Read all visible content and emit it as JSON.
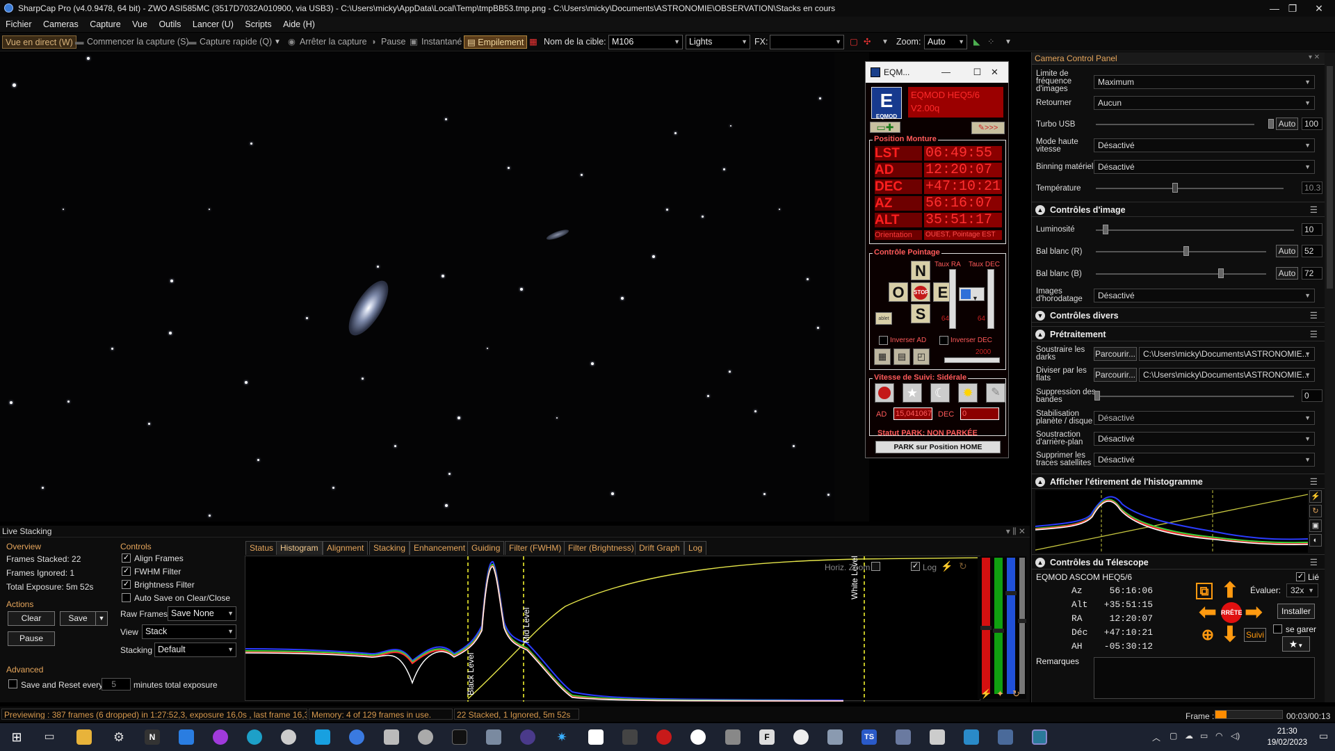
{
  "window": {
    "title": "SharpCap Pro (v4.0.9478, 64 bit) - ZWO ASI585MC (3517D7032A010900, via USB3) - C:\\Users\\micky\\AppData\\Local\\Temp\\tmpBB53.tmp.png - C:\\Users\\micky\\Documents\\ASTRONOMIE\\OBSERVATION\\Stacks en cours",
    "minimize": "—",
    "maximize": "❐",
    "close": "✕"
  },
  "menu": [
    "Fichier",
    "Cameras",
    "Capture",
    "Vue",
    "Outils",
    "Lancer (U)",
    "Scripts",
    "Aide (H)"
  ],
  "toolbar": {
    "live_view": "Vue en direct (W)",
    "start_capture": "Commencer la capture (S)",
    "quick_capture": "Capture rapide (Q)",
    "stop_capture": "Arrêter la capture",
    "pause": "Pause",
    "snapshot": "Instantané",
    "stacking": "Empilement",
    "target_label": "Nom de la cible:",
    "target_value": "M106",
    "frame_type": "Lights",
    "fx_label": "FX:",
    "fx_value": "",
    "zoom_label": "Zoom:",
    "zoom_value": "Auto"
  },
  "eqmod": {
    "window_title": "EQM...",
    "mount_name": "EQMOD HEQ5/6",
    "version": "V2.00q",
    "position_title": "Position Monture",
    "rows": [
      {
        "label": "LST",
        "value": "06:49:55"
      },
      {
        "label": "AD",
        "value": "12:20:07"
      },
      {
        "label": "DEC",
        "value": "+47:10:21"
      },
      {
        "label": "AZ",
        "value": "56:16:07"
      },
      {
        "label": "ALT",
        "value": "35:51:17"
      }
    ],
    "orientation_label": "Orientation",
    "orientation_value": "OUEST, Pointage EST",
    "slew_title": "Contrôle Pointage",
    "rate_ra": "Taux RA",
    "rate_dec": "Taux DEC",
    "btn_n": "N",
    "btn_s": "S",
    "btn_e": "E",
    "btn_o": "O",
    "btn_stop": "STOP",
    "rate_ra_val": "64",
    "rate_dec_val": "64",
    "invert_ad": "Inverser AD",
    "invert_dec": "Inverser DEC",
    "pulse_val": "2000",
    "tablet_label": "ablet",
    "tracking_title": "Vitesse de Suivi: Sidérale",
    "ad_label": "AD",
    "ad_value": "15,041067",
    "dec_label": "DEC",
    "dec_value": "0",
    "park_status": "Statut PARK: NON PARKÉE",
    "park_button": "PARK sur Position HOME"
  },
  "camera_panel": {
    "title": "Camera Control Panel",
    "frame_rate_label": "Limite de fréquence d'images",
    "frame_rate_value": "Maximum",
    "flip_label": "Retourner",
    "flip_value": "Aucun",
    "turbo_label": "Turbo USB",
    "turbo_auto": "Auto",
    "turbo_value": "100",
    "hispeed_label": "Mode haute vitesse",
    "hispeed_value": "Désactivé",
    "binning_label": "Binning matériel",
    "binning_value": "Désactivé",
    "temp_label": "Température",
    "temp_value": "10.3",
    "image_controls": "Contrôles d'image",
    "luminosity_label": "Luminosité",
    "luminosity_value": "10",
    "wb_r_label": "Bal blanc (R)",
    "wb_r_auto": "Auto",
    "wb_r_value": "52",
    "wb_b_label": "Bal blanc (B)",
    "wb_b_auto": "Auto",
    "wb_b_value": "72",
    "timestamp_label": "Images d'horodatage",
    "timestamp_value": "Désactivé",
    "misc_controls": "Contrôles divers",
    "preprocessing": "Prétraitement",
    "darks_label": "Soustraire les darks",
    "darks_btn": "Parcourir...",
    "darks_path": "C:\\Users\\micky\\Documents\\ASTRONOMIE...",
    "flats_label": "Diviser par les flats",
    "flats_btn": "Parcourir...",
    "flats_path": "C:\\Users\\micky\\Documents\\ASTRONOMIE...",
    "banding_label": "Suppression des bandes",
    "banding_value": "0",
    "stabilization_label": "Stabilisation planète / disque",
    "stabilization_value": "Désactivé",
    "bg_sub_label": "Soustraction d'arrière-plan",
    "bg_sub_value": "Désactivé",
    "sat_label": "Supprimer les traces satellites",
    "sat_value": "Désactivé",
    "histogram_stretch": "Afficher l'étirement de l'histogramme",
    "telescope_controls": "Contrôles du Télescope",
    "telescope_name": "EQMOD ASCOM HEQ5/6",
    "linked_label": "Lié",
    "az": "Az     56:16:06",
    "alt": "Alt   +35:51:15",
    "ra": "RA     12:20:07",
    "dec": "Déc   +47:10:21",
    "ah": "AH    -05:30:12",
    "rate_label": "Évaluer:",
    "rate_value": "32x",
    "install_btn": "Installer",
    "park_label": "se garer",
    "stop_btn": "RRÊTE",
    "follow_btn": "Suivi",
    "notes_label": "Remarques"
  },
  "live_stacking": {
    "title": "Live Stacking",
    "overview_head": "Overview",
    "frames_stacked": "Frames Stacked: 22",
    "frames_ignored": "Frames Ignored: 1",
    "total_exposure": "Total Exposure:   5m 52s",
    "actions_head": "Actions",
    "clear_btn": "Clear",
    "save_btn": "Save",
    "pause_btn": "Pause",
    "advanced_head": "Advanced",
    "save_reset_label": "Save and Reset every",
    "save_reset_value": "5",
    "save_reset_unit": "minutes total exposure",
    "controls_head": "Controls",
    "align_frames": "Align Frames",
    "fwhm_filter": "FWHM Filter",
    "brightness_filter": "Brightness Filter",
    "autosave": "Auto Save on Clear/Close",
    "raw_frames_label": "Raw Frames",
    "raw_frames_value": "Save None",
    "view_label": "View",
    "view_value": "Stack",
    "stacking_label": "Stacking",
    "stacking_value": "Default",
    "tabs": [
      "Status",
      "Histogram",
      "Alignment",
      "Stacking",
      "Enhancement",
      "Guiding",
      "Filter (FWHM)",
      "Filter (Brightness)",
      "Drift Graph",
      "Log"
    ],
    "horiz_label": "Horiz. Zoom",
    "log_label": "Log",
    "black_level": "Black Level",
    "mid_level": "Mid Level",
    "white_level": "White Level"
  },
  "status_bar": {
    "previewing": "Previewing : 387 frames (6 dropped) in 1:27:52,3, exposure 16,0s , last frame 16,3s",
    "memory": "Memory: 4 of 129 frames in use.",
    "stacked": "22 Stacked, 1 Ignored, 5m 52s",
    "frame_label": "Frame :",
    "frame_time": "00:03/00:13"
  },
  "taskbar": {
    "time": "21:30",
    "date": "19/02/2023"
  },
  "colors": {
    "accent_orange": "#e6a65c",
    "eqmod_red": "#ff2a2a",
    "histogram_yellow": "#e6e64a"
  }
}
